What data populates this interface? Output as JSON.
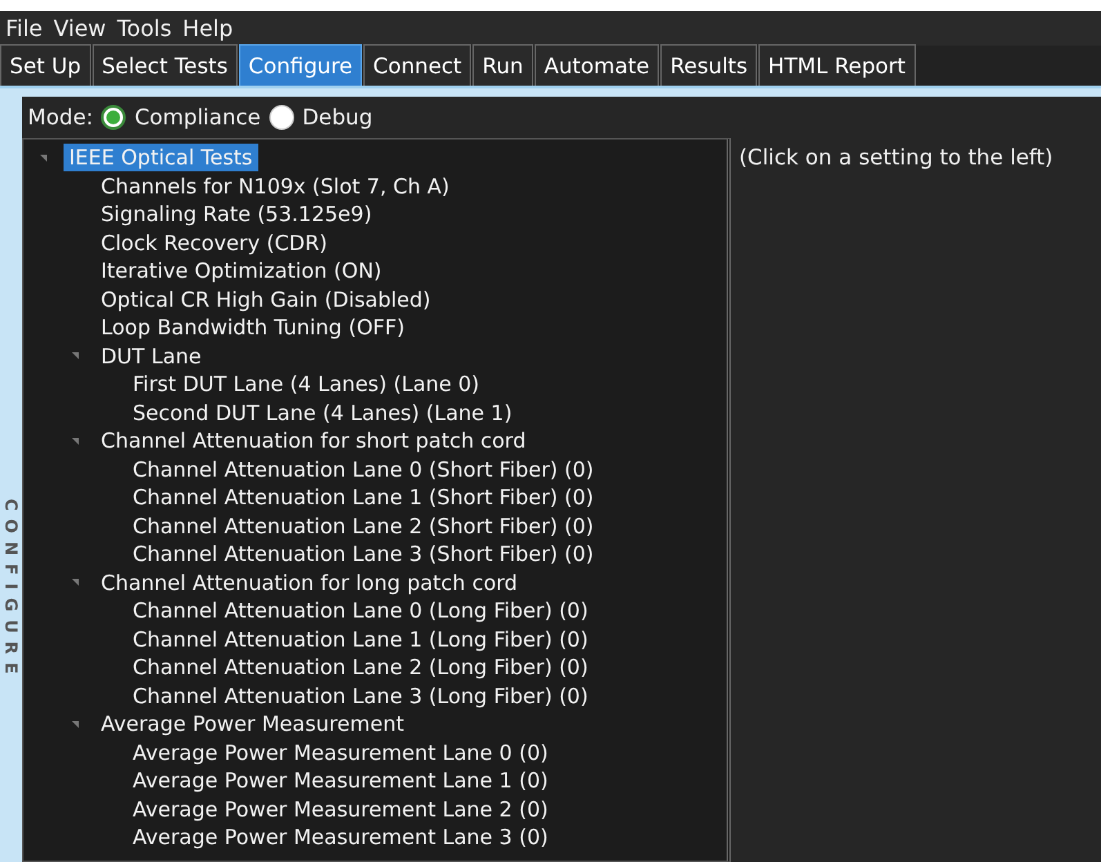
{
  "menu": [
    "File",
    "View",
    "Tools",
    "Help"
  ],
  "tabs": [
    {
      "label": "Set Up",
      "selected": false
    },
    {
      "label": "Select Tests",
      "selected": false
    },
    {
      "label": "Configure",
      "selected": true
    },
    {
      "label": "Connect",
      "selected": false
    },
    {
      "label": "Run",
      "selected": false
    },
    {
      "label": "Automate",
      "selected": false
    },
    {
      "label": "Results",
      "selected": false
    },
    {
      "label": "HTML Report",
      "selected": false
    }
  ],
  "side_label": "CONFIGURE",
  "mode": {
    "label": "Mode:",
    "options": [
      {
        "label": "Compliance",
        "selected": true
      },
      {
        "label": "Debug",
        "selected": false
      }
    ]
  },
  "tree": [
    {
      "label": "IEEE Optical Tests",
      "selected": true,
      "expanded": true,
      "children": [
        {
          "label": "Channels for N109x (Slot 7, Ch A)",
          "selected": false
        },
        {
          "label": "Signaling Rate (53.125e9)",
          "selected": false
        },
        {
          "label": "Clock Recovery (CDR)",
          "selected": false
        },
        {
          "label": "Iterative Optimization (ON)",
          "selected": false
        },
        {
          "label": "Optical CR High Gain (Disabled)",
          "selected": false
        },
        {
          "label": "Loop Bandwidth Tuning (OFF)",
          "selected": false
        },
        {
          "label": "DUT Lane",
          "selected": false,
          "expanded": true,
          "children": [
            {
              "label": "First DUT Lane (4 Lanes) (Lane 0)",
              "selected": false
            },
            {
              "label": "Second DUT Lane (4 Lanes) (Lane 1)",
              "selected": false
            }
          ]
        },
        {
          "label": "Channel Attenuation for short patch cord",
          "selected": false,
          "expanded": true,
          "children": [
            {
              "label": "Channel Attenuation Lane 0 (Short Fiber) (0)",
              "selected": false
            },
            {
              "label": "Channel Attenuation Lane 1 (Short Fiber) (0)",
              "selected": false
            },
            {
              "label": "Channel Attenuation Lane 2 (Short Fiber) (0)",
              "selected": false
            },
            {
              "label": "Channel Attenuation Lane 3 (Short Fiber) (0)",
              "selected": false
            }
          ]
        },
        {
          "label": "Channel Attenuation for long patch cord",
          "selected": false,
          "expanded": true,
          "children": [
            {
              "label": "Channel Attenuation Lane 0 (Long Fiber) (0)",
              "selected": false
            },
            {
              "label": "Channel Attenuation Lane 1 (Long Fiber) (0)",
              "selected": false
            },
            {
              "label": "Channel Attenuation Lane 2 (Long Fiber) (0)",
              "selected": false
            },
            {
              "label": "Channel Attenuation Lane 3 (Long Fiber) (0)",
              "selected": false
            }
          ]
        },
        {
          "label": "Average Power Measurement",
          "selected": false,
          "expanded": true,
          "children": [
            {
              "label": "Average Power Measurement Lane 0 (0)",
              "selected": false
            },
            {
              "label": "Average Power Measurement Lane 1 (0)",
              "selected": false
            },
            {
              "label": "Average Power Measurement Lane 2 (0)",
              "selected": false
            },
            {
              "label": "Average Power Measurement Lane 3 (0)",
              "selected": false
            }
          ]
        }
      ]
    }
  ],
  "detail_hint": "(Click on a setting to the left)"
}
